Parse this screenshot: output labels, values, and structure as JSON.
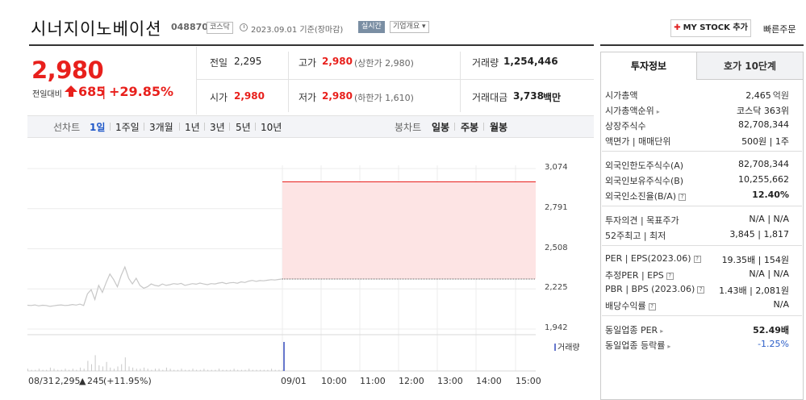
{
  "header": {
    "company_name": "시너지이노베이션",
    "stock_code": "048870",
    "market_tag": "코스닥",
    "as_of": "2023.09.01  기준(장마감)",
    "realtime_label": "실시간",
    "company_info_label": "기업개요 ▾",
    "mystock_label": "MY STOCK 추가",
    "quick_order_label": "빠른주문"
  },
  "price": {
    "current": "2,980",
    "vs_prev_label": "전일대비",
    "change": "685",
    "separator": "|",
    "change_rate": "+29.85%",
    "color_up": "#e8201c"
  },
  "stats": {
    "prev_close_label": "전일",
    "prev_close": "2,295",
    "high_label": "고가",
    "high": "2,980",
    "high_sub": "(상한가 2,980)",
    "volume_label": "거래량",
    "volume": "1,254,446",
    "open_label": "시가",
    "open": "2,980",
    "low_label": "저가",
    "low": "2,980",
    "low_sub": "(하한가 1,610)",
    "amount_label": "거래대금",
    "amount": "3,738",
    "amount_unit": "백만"
  },
  "chart_tabs": {
    "line_label": "선차트",
    "line_items": [
      "1일",
      "1주일",
      "3개월",
      "1년",
      "3년",
      "5년",
      "10년"
    ],
    "active": "1일",
    "candle_label": "봉차트",
    "candle_items": [
      "일봉",
      "주봉",
      "월봉"
    ]
  },
  "chart_data": {
    "type": "line",
    "y_ticks": [
      "3,074",
      "2,791",
      "2,508",
      "2,225",
      "1,942"
    ],
    "ylim": [
      1942,
      3074
    ],
    "x_labels": [
      "08/31",
      "09/01",
      "10:00",
      "11:00",
      "12:00",
      "13:00",
      "14:00",
      "15:00"
    ],
    "prev_day_summary": {
      "date": "08/31",
      "close": "2,295",
      "change": "245",
      "rate": "(+11.95%)"
    },
    "upper_limit": 2980,
    "prev_close": 2295,
    "volume_label": "거래량",
    "series": [
      {
        "name": "08/31",
        "y": [
          2110,
          2108,
          2112,
          2105,
          2110,
          2108,
          2102,
          2106,
          2110,
          2112,
          2108,
          2110,
          2115,
          2111,
          2118,
          2108,
          2190,
          2220,
          2150,
          2250,
          2200,
          2270,
          2330,
          2290,
          2240,
          2320,
          2380,
          2300,
          2260,
          2300,
          2250,
          2230,
          2240,
          2260,
          2250,
          2245,
          2260,
          2250,
          2255,
          2262,
          2258,
          2264,
          2250,
          2256,
          2262,
          2258,
          2266,
          2260,
          2255,
          2262,
          2260,
          2266,
          2270,
          2262,
          2268,
          2270,
          2265,
          2275,
          2270,
          2280,
          2285,
          2278,
          2284,
          2282,
          2286,
          2290,
          2288,
          2292,
          2295
        ]
      },
      {
        "name": "09/01",
        "y": [
          2980,
          2980
        ]
      }
    ]
  },
  "side_panel": {
    "tab_invest": "투자정보",
    "tab_hoga": "호가 10단계",
    "sec1": [
      {
        "label": "시가총액",
        "value": "2,465",
        "unit": "억원"
      },
      {
        "label": "시가총액순위",
        "value": "코스닥 363위",
        "unit": "",
        "arrow": true
      },
      {
        "label": "상장주식수",
        "value": "82,708,344",
        "unit": ""
      },
      {
        "label": "액면가 | 매매단위",
        "value": "500원 | 1주",
        "unit": ""
      }
    ],
    "sec2": [
      {
        "label": "외국인한도주식수(A)",
        "value": "82,708,344"
      },
      {
        "label": "외국인보유주식수(B)",
        "value": "10,255,662"
      },
      {
        "label": "외국인소진율(B/A)",
        "value": "12.40%",
        "q": true,
        "bold": true
      }
    ],
    "sec3": [
      {
        "label": "투자의견 | 목표주가",
        "value": "N/A | N/A"
      },
      {
        "label": "52주최고 | 최저",
        "value": "3,845 | 1,817"
      }
    ],
    "sec4": [
      {
        "label": "PER | EPS(2023.06)",
        "value": "19.35배 | 154원",
        "q": true
      },
      {
        "label": "추정PER | EPS",
        "value": "N/A | N/A",
        "q": true
      },
      {
        "label": "PBR | BPS (2023.06)",
        "value": "1.43배 | 2,081원",
        "q": true
      },
      {
        "label": "배당수익률",
        "value": "N/A",
        "q": true
      }
    ],
    "sec5": [
      {
        "label": "동일업종 PER",
        "value": "52.49배",
        "arrow": true,
        "bold": true
      },
      {
        "label": "동일업종 등락률",
        "value": "-1.25%",
        "arrow": true,
        "blue": true
      }
    ]
  }
}
